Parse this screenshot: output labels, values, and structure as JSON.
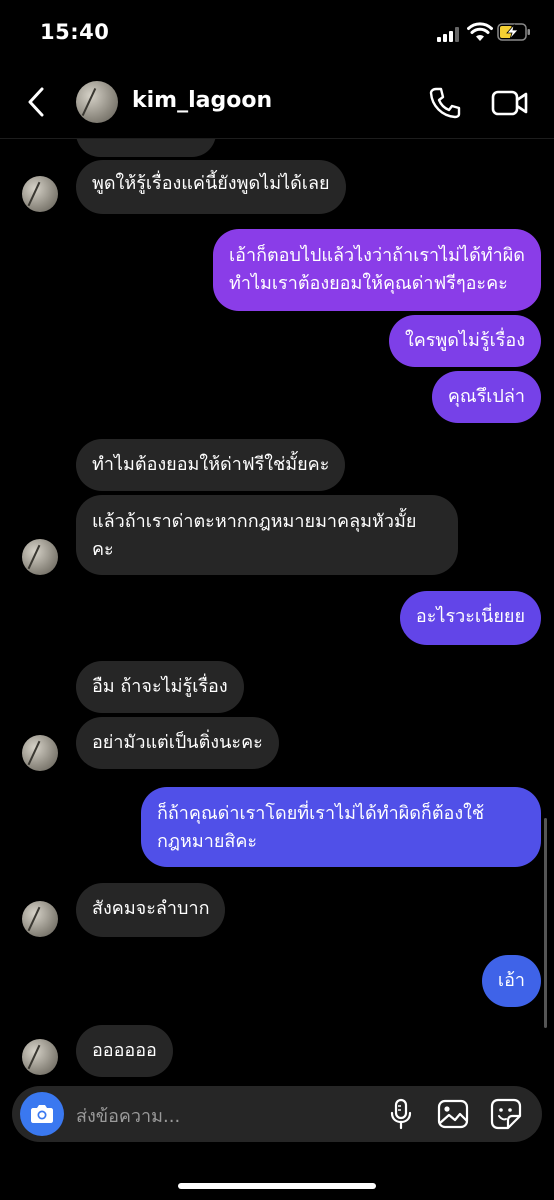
{
  "status": {
    "time": "15:40"
  },
  "header": {
    "username": "kim_lagoon"
  },
  "messages": [
    {
      "text": "พูดให้รู้เรื่องแค่นี้ยังพูดไม่ได้เลย"
    },
    {
      "line1": "เอ้าก็ตอบไปแล้วไงว่าถ้าเราไม่ได้ทำผิด",
      "line2": "ทำไมเราต้องยอมให้คุณด่าฟรีๆอะคะ"
    },
    {
      "text": "ใครพูดไม่รู้เรื่อง"
    },
    {
      "text": "คุณรึเปล่า"
    },
    {
      "text": "ทำไมต้องยอมให้ด่าฟรีใช่มั้ยคะ"
    },
    {
      "line1": "แล้วถ้าเราด่าตะหากกฎหมายมาคลุมหัวมั้ย",
      "line2": "คะ"
    },
    {
      "text": "อะไรวะเนี่ยยย"
    },
    {
      "text": "อืม ถ้าจะไม่รู้เรื่อง"
    },
    {
      "text": "อย่ามัวแต่เป็นติ่งนะคะ"
    },
    {
      "line1": "ก็ถ้าคุณด่าเราโดยที่เราไม่ได้ทำผิดก็ต้องใช้",
      "line2": "กฎหมายสิคะ"
    },
    {
      "text": "สังคมจะลำบาก"
    },
    {
      "text": "เอ้า"
    },
    {
      "text": "ออออออ"
    }
  ],
  "composer": {
    "placeholder": "ส่งข้อความ..."
  },
  "colors": {
    "incoming": "#262626",
    "outgoing_top": "#8a3de8",
    "outgoing_bottom": "#3f63e8",
    "camera": "#3a78f0"
  },
  "icons": [
    "back-icon",
    "phone-icon",
    "video-camera-icon",
    "camera-icon",
    "microphone-icon",
    "gallery-icon",
    "sticker-icon"
  ]
}
